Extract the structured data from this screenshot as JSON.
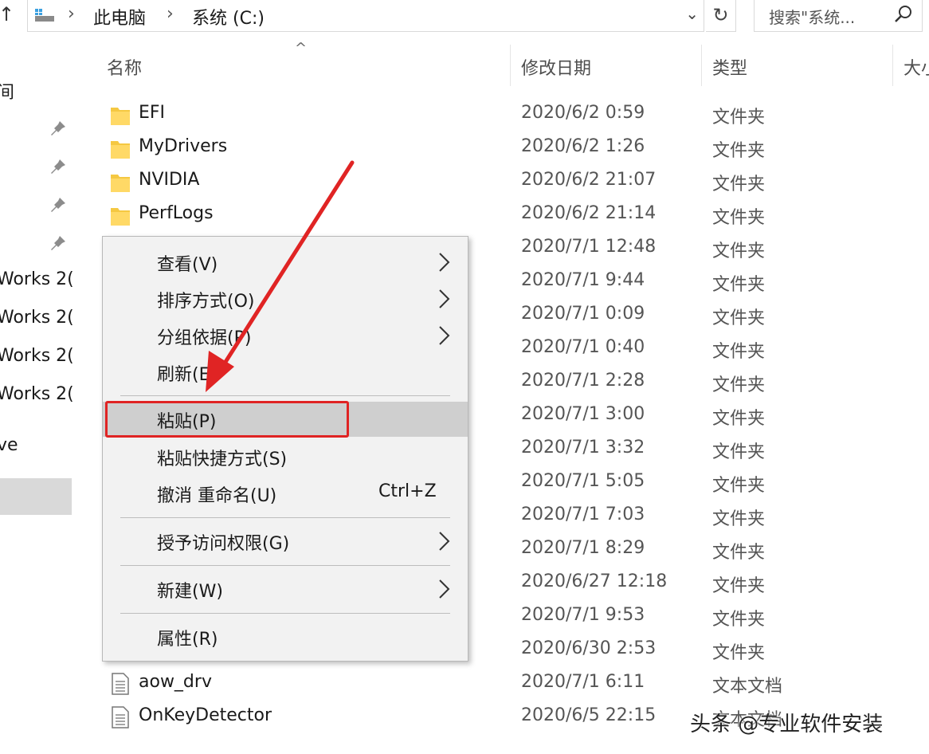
{
  "address_bar": {
    "crumbs": [
      "此电脑",
      "系统 (C:)"
    ]
  },
  "search": {
    "placeholder": "搜索\"系统..."
  },
  "nav": {
    "frag_top": "间",
    "works": [
      "Works 2(",
      "Works 2(",
      "Works 2(",
      "Works 2("
    ],
    "frag_ve": "ve"
  },
  "columns": {
    "name": "名称",
    "modified": "修改日期",
    "type": "类型",
    "size": "大小"
  },
  "files": [
    {
      "name": "EFI",
      "date": "2020/6/2 0:59",
      "type": "文件夹",
      "kind": "folder"
    },
    {
      "name": "MyDrivers",
      "date": "2020/6/2 1:26",
      "type": "文件夹",
      "kind": "folder"
    },
    {
      "name": "NVIDIA",
      "date": "2020/6/2 21:07",
      "type": "文件夹",
      "kind": "folder"
    },
    {
      "name": "PerfLogs",
      "date": "2020/6/2 21:14",
      "type": "文件夹",
      "kind": "folder"
    },
    {
      "name": "",
      "date": "2020/7/1 12:48",
      "type": "文件夹",
      "kind": "folder"
    },
    {
      "name": "",
      "date": "2020/7/1 9:44",
      "type": "文件夹",
      "kind": "folder"
    },
    {
      "name": "",
      "date": "2020/7/1 0:09",
      "type": "文件夹",
      "kind": "folder"
    },
    {
      "name": "",
      "date": "2020/7/1 0:40",
      "type": "文件夹",
      "kind": "folder"
    },
    {
      "name": "",
      "date": "2020/7/1 2:28",
      "type": "文件夹",
      "kind": "folder"
    },
    {
      "name": "",
      "date": "2020/7/1 3:00",
      "type": "文件夹",
      "kind": "folder"
    },
    {
      "name": "",
      "date": "2020/7/1 3:32",
      "type": "文件夹",
      "kind": "folder"
    },
    {
      "name": "",
      "date": "2020/7/1 5:05",
      "type": "文件夹",
      "kind": "folder"
    },
    {
      "name": "",
      "date": "2020/7/1 7:03",
      "type": "文件夹",
      "kind": "folder"
    },
    {
      "name": "",
      "date": "2020/7/1 8:29",
      "type": "文件夹",
      "kind": "folder"
    },
    {
      "name": "",
      "date": "2020/6/27 12:18",
      "type": "文件夹",
      "kind": "folder"
    },
    {
      "name": "",
      "date": "2020/7/1 9:53",
      "type": "文件夹",
      "kind": "folder"
    },
    {
      "name": "",
      "date": "2020/6/30 2:53",
      "type": "文件夹",
      "kind": "folder"
    },
    {
      "name": "aow_drv",
      "date": "2020/7/1 6:11",
      "type": "文本文档",
      "kind": "doc"
    },
    {
      "name": "OnKeyDetector",
      "date": "2020/6/5 22:15",
      "type": "文本文档",
      "kind": "doc"
    }
  ],
  "context_menu": {
    "view": "查看(V)",
    "sort": "排序方式(O)",
    "group": "分组依据(P)",
    "refresh": "刷新(E)",
    "paste": "粘贴(P)",
    "paste_shortcut": "粘贴快捷方式(S)",
    "undo": "撤消 重命名(U)",
    "undo_shortcut": "Ctrl+Z",
    "grant": "授予访问权限(G)",
    "new": "新建(W)",
    "properties": "属性(R)"
  },
  "annotation": {
    "color": "#e02424"
  },
  "watermark": "头条 @专业软件安装"
}
